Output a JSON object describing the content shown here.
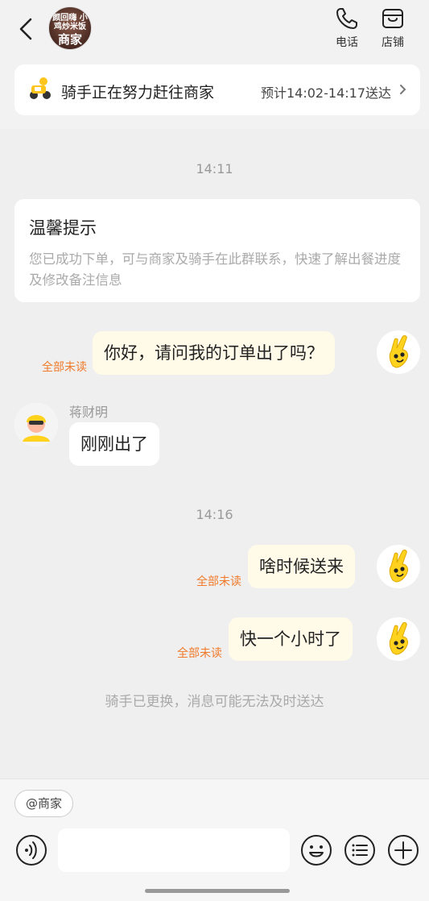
{
  "header": {
    "shop_logo_text": "颜回嗨 小鸡炒米饭",
    "shop_label": "商家",
    "phone_label": "电话",
    "store_label": "店铺"
  },
  "status": {
    "text": "骑手正在努力赶往商家",
    "eta": "预计14:02-14:17送达"
  },
  "times": [
    "14:11",
    "14:16"
  ],
  "tip": {
    "title": "温馨提示",
    "body": "您已成功下单，可与商家及骑手在此群联系，快速了解出餐进度及修改备注信息"
  },
  "messages": [
    {
      "text": "你好，请问我的订单出了吗？",
      "unread": "全部未读"
    },
    {
      "sender": "蒋财明",
      "text": "刚刚出了"
    },
    {
      "text": "啥时候送来",
      "unread": "全部未读"
    },
    {
      "text": "快一个小时了",
      "unread": "全部未读"
    }
  ],
  "system_note": "骑手已更换，消息可能无法及时送达",
  "input": {
    "mention": "@商家",
    "placeholder": ""
  },
  "colors": {
    "unread": "#f07a2a",
    "outgoing_bubble": "#fffbe8",
    "accent_yellow": "#ffd21e"
  },
  "icons": [
    "back-arrow-icon",
    "phone-icon",
    "store-icon",
    "scooter-icon",
    "chevron-right-icon",
    "voice-icon",
    "emoji-icon",
    "quick-reply-icon",
    "plus-icon"
  ]
}
